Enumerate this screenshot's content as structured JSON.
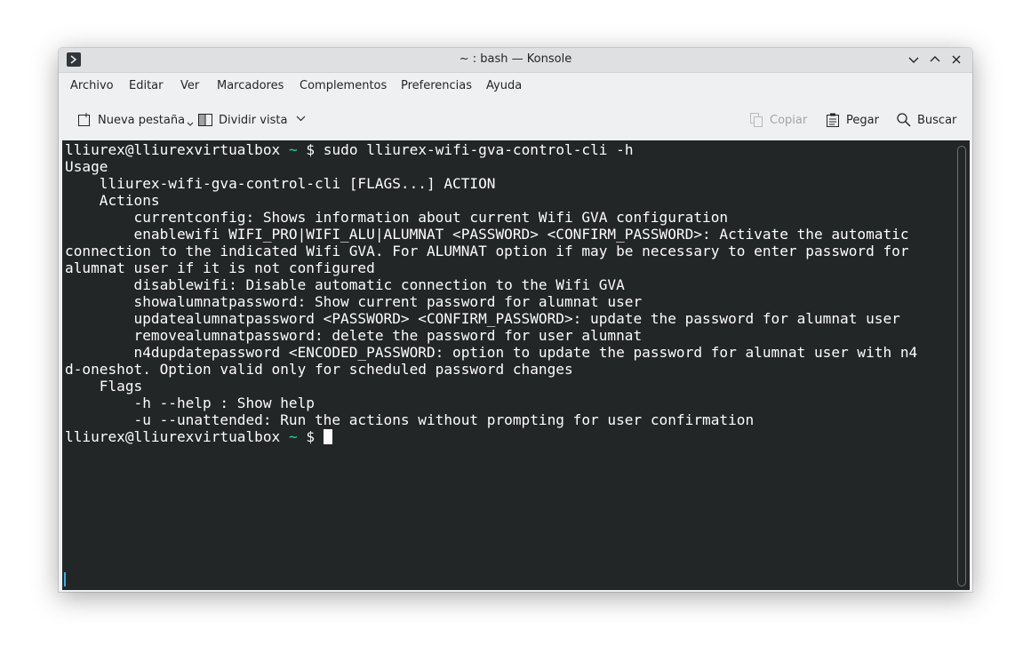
{
  "window": {
    "title": "~ : bash — Konsole",
    "app_icon": "terminal-icon",
    "controls": [
      "minimize-icon",
      "maximize-icon",
      "close-icon"
    ]
  },
  "menubar": {
    "items": [
      "Archivo",
      "Editar",
      "Ver",
      "Marcadores",
      "Complementos",
      "Preferencias",
      "Ayuda"
    ]
  },
  "toolbar": {
    "new_tab": "Nueva pestaña",
    "split_view": "Dividir vista",
    "copy": "Copiar",
    "paste": "Pegar",
    "find": "Buscar"
  },
  "terminal": {
    "prompt_user": "lliurex@lliurexvirtualbox",
    "prompt_dir": "~",
    "prompt_symbol": "$",
    "command": "sudo lliurex-wifi-gva-control-cli -h",
    "output_lines": [
      "Usage",
      "    lliurex-wifi-gva-control-cli [FLAGS...] ACTION",
      "    Actions",
      "        currentconfig: Shows information about current Wifi GVA configuration",
      "        enablewifi WIFI_PRO|WIFI_ALU|ALUMNAT <PASSWORD> <CONFIRM_PASSWORD>: Activate the automatic",
      "connection to the indicated Wifi GVA. For ALUMNAT option if may be necessary to enter password for",
      "alumnat user if it is not configured",
      "        disablewifi: Disable automatic connection to the Wifi GVA",
      "        showalumnatpassword: Show current password for alumnat user",
      "        updatealumnatpassword <PASSWORD> <CONFIRM_PASSWORD>: update the password for alumnat user",
      "        removealumnatpassword: delete the password for user alumnat",
      "        n4dupdatepassword <ENCODED_PASSWORD: option to update the password for alumnat user with n4",
      "d-oneshot. Option valid only for scheduled password changes",
      "    Flags",
      "        -h --help : Show help",
      "        -u --unattended: Run the actions without prompting for user confirmation"
    ]
  },
  "colors": {
    "terminal_bg": "#232627",
    "terminal_fg": "#fcfcfc",
    "prompt_tilde": "#1cdc9a",
    "window_bg": "#eff0f1"
  }
}
